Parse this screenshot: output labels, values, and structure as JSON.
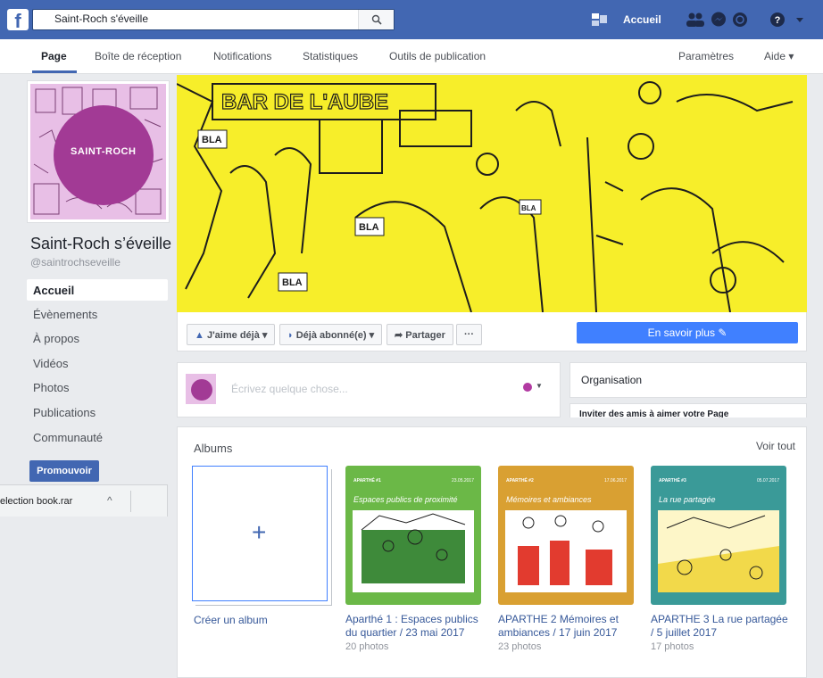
{
  "topbar": {
    "logo": "f",
    "search_value": "Saint-Roch s'éveille",
    "accueil": "Accueil"
  },
  "pagenav": {
    "items": [
      "Page",
      "Boîte de réception",
      "Notifications",
      "Statistiques",
      "Outils de publication"
    ],
    "right_items": [
      "Paramètres",
      "Aide ▾"
    ]
  },
  "sidebar": {
    "profile_text": "SAINT-ROCH",
    "page_name": "Saint-Roch s’éveille",
    "page_handle": "@saintrochseveille",
    "items": [
      "Accueil",
      "Évènements",
      "À propos",
      "Vidéos",
      "Photos",
      "Publications",
      "Communauté"
    ],
    "promote": "Promouvoir"
  },
  "download": {
    "name": "election book.rar",
    "caret": "^"
  },
  "cover": {
    "sign": "BAR DE L'AUBE",
    "bubbles": [
      "BLA",
      "BLA",
      "BLA",
      "BLA"
    ]
  },
  "cover_actions": {
    "like": "J'aime déjà ▾",
    "follow": "Déjà abonné(e) ▾",
    "share": "Partager",
    "more": "···",
    "cta": "En savoir plus ✎"
  },
  "composer": {
    "placeholder": "Écrivez quelque chose...",
    "caret": "▼"
  },
  "right_panel": {
    "organisation": "Organisation",
    "invite": "Inviter des amis à aimer votre Page"
  },
  "albums": {
    "title": "Albums",
    "see_all": "Voir tout",
    "create_plus": "+",
    "create_label": "Créer un album",
    "items": [
      {
        "head_num": "APARTHÉ #1",
        "head_date": "23.05.2017",
        "subtitle": "Espaces publics de proximité",
        "title": "Aparthé 1 : Espaces publics du quartier / 23 mai 2017",
        "count": "20 photos",
        "color": "#6bb847"
      },
      {
        "head_num": "APARTHÉ #2",
        "head_date": "17.06.2017",
        "subtitle": "Mémoires et ambiances",
        "title": "APARTHE 2 Mémoires et ambiances / 17 juin 2017",
        "count": "23 photos",
        "color": "#d9a032"
      },
      {
        "head_num": "APARTHÉ #3",
        "head_date": "05.07.2017",
        "subtitle": "La rue partagée",
        "title": "APARTHE 3 La rue partagée / 5 juillet 2017",
        "count": "17 photos",
        "color": "#3a9a98"
      }
    ]
  },
  "colors": {
    "brand": "#4267b2",
    "cta": "#4080ff",
    "cover": "#f7ee2a",
    "profile": "#a23a95"
  }
}
